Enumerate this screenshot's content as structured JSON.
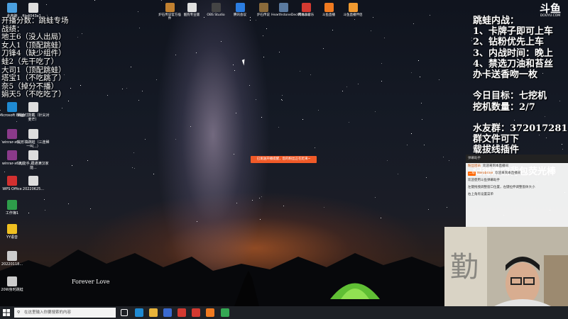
{
  "desktop": {
    "top_icons": [
      {
        "label": "炉石传说官方插件",
        "color": "#c08030"
      },
      {
        "label": "酷狗专业版",
        "color": "#e0e0e0"
      },
      {
        "label": "OBS Studio",
        "color": "#444444"
      },
      {
        "label": "腾讯会议",
        "color": "#2b7de1"
      },
      {
        "label": "炉石传说",
        "color": "#8a6a3a"
      },
      {
        "label": "HearthstoneDeckTracker",
        "color": "#5a7aa0"
      },
      {
        "label": "网易云音乐",
        "color": "#d33a31"
      },
      {
        "label": "斗鱼直播",
        "color": "#f07a20"
      },
      {
        "label": "斗鱼直播伴侣",
        "color": "#f09a30"
      }
    ],
    "left_icons": [
      {
        "label": "此电脑",
        "color": "#4aa0e0"
      },
      {
        "label": "Microsoft Edge",
        "color": "#1f8ad2"
      },
      {
        "label": "跳蛙付款截（针尖对麦芒）",
        "color": "#dddddd"
      },
      {
        "label": "winrar-x6...",
        "color": "#8a3a8a"
      },
      {
        "label": "完形填跳蛙（三连稀一叫...）",
        "color": "#dddddd"
      },
      {
        "label": "winrar-x6...",
        "color": "#8a3a8a"
      },
      {
        "label": "满J能手,跟通满汉家能...",
        "color": "#dddddd"
      },
      {
        "label": "WPS Office",
        "color": "#d23030"
      },
      {
        "label": "20220625...",
        "color": "#dddddd"
      },
      {
        "label": "工作簿1",
        "color": "#2e9d4a"
      },
      {
        "label": "YY语音",
        "color": "#f0c020"
      },
      {
        "label": "20220118...",
        "color": "#cccccc"
      },
      {
        "label": "20W身时跳蛙",
        "color": "#cccccc"
      }
    ],
    "top_left_file": "file4043e1..."
  },
  "overlay_left": [
    "开播分数：跳蛙专场",
    "战绩：",
    "地王6（没人出局）",
    "女人1（顶配跳蛙）",
    "刀锋4（缺少组件）",
    "蛙2（先干吃了）",
    "大司1（顶配跳蛙）",
    "塔宝1（不吃跳了）",
    "奈5（掉分不播）",
    "娟天5（不吃吃了）"
  ],
  "overlay_right": [
    "跳蛙内战：",
    "1、卡牌子即可上车",
    "2、钻粉优先上车",
    "3、内战时间：晚上",
    "4、禁选刀油和苔丝",
    "办卡送香吻一枚",
    "",
    "今日目标：七挖机",
    "挖机数量：2/7",
    "",
    "水友群：372017281",
    "群文件可下",
    "载拔线插件",
    "",
    "记得清空背包荧光棒"
  ],
  "logo": {
    "big": "斗鱼",
    "small": "DOUYU.COM"
  },
  "chat": {
    "header": "弹幕助手",
    "messages": [
      {
        "badge": "",
        "user": "粉丝团员",
        "text": "欢迎来到本直播间"
      },
      {
        "badge": "二级",
        "user": "Herobrine",
        "text": "欢迎来到本直播间"
      },
      {
        "badge": "",
        "user": "",
        "text": "欢迎使用斗鱼弹幕助手"
      },
      {
        "badge": "",
        "user": "",
        "text": "左键拖拽调整窗口位置，左键拉伸调整窗体大小"
      },
      {
        "badge": "",
        "user": "",
        "text": "右上角有设置菜单"
      }
    ]
  },
  "toast": "已发送开播提醒，您的粉丝正在赶来~",
  "wallpaper_caption": "Forever Love",
  "taskbar": {
    "search_placeholder": "在这里输入你要搜索的内容",
    "apps": [
      {
        "name": "task-view",
        "color": "#ffffff"
      },
      {
        "name": "edge",
        "color": "#1f8ad2"
      },
      {
        "name": "file-explorer",
        "color": "#e8b33a"
      },
      {
        "name": "store",
        "color": "#3a6ad0"
      },
      {
        "name": "netease-music",
        "color": "#d33a31"
      },
      {
        "name": "netease-music-2",
        "color": "#d33a31"
      },
      {
        "name": "douyu",
        "color": "#f07a20"
      },
      {
        "name": "chrome",
        "color": "#34a853"
      }
    ]
  }
}
